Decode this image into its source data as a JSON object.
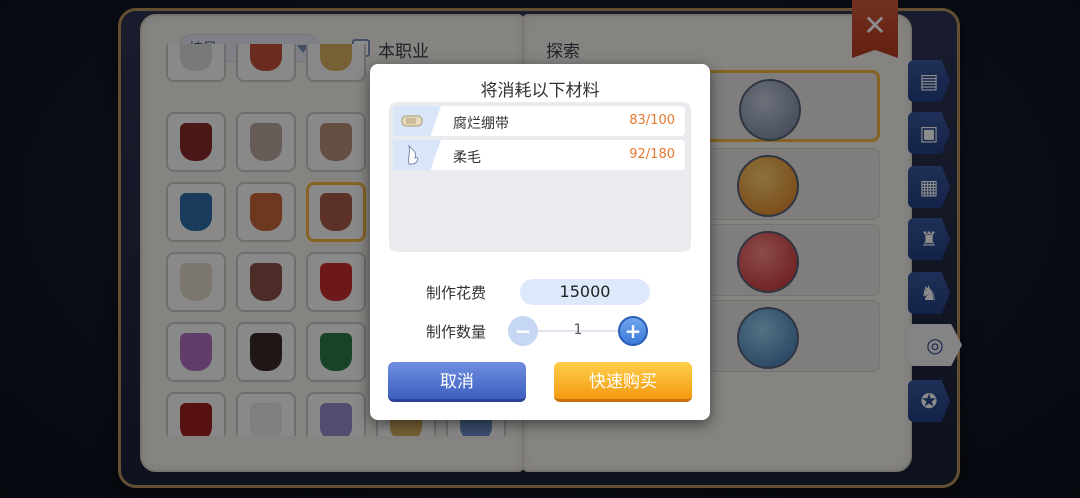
{
  "left_page": {
    "filter_dropdown": "披风",
    "job_checkbox_label": "本职业"
  },
  "right_page": {
    "title": "探索"
  },
  "modal": {
    "title": "将消耗以下材料",
    "materials": [
      {
        "name": "腐烂绷带",
        "count": "83/100"
      },
      {
        "name": "柔毛",
        "count": "92/180"
      }
    ],
    "cost_label": "制作花费",
    "cost_value": "15000",
    "quantity_label": "制作数量",
    "quantity_value": "1",
    "cancel_label": "取消",
    "buy_label": "快速购买"
  },
  "close_label": "✕",
  "colors": {
    "accent_orange": "#f39a12",
    "accent_blue": "#3e5fc0",
    "count_orange": "#e87a32"
  }
}
